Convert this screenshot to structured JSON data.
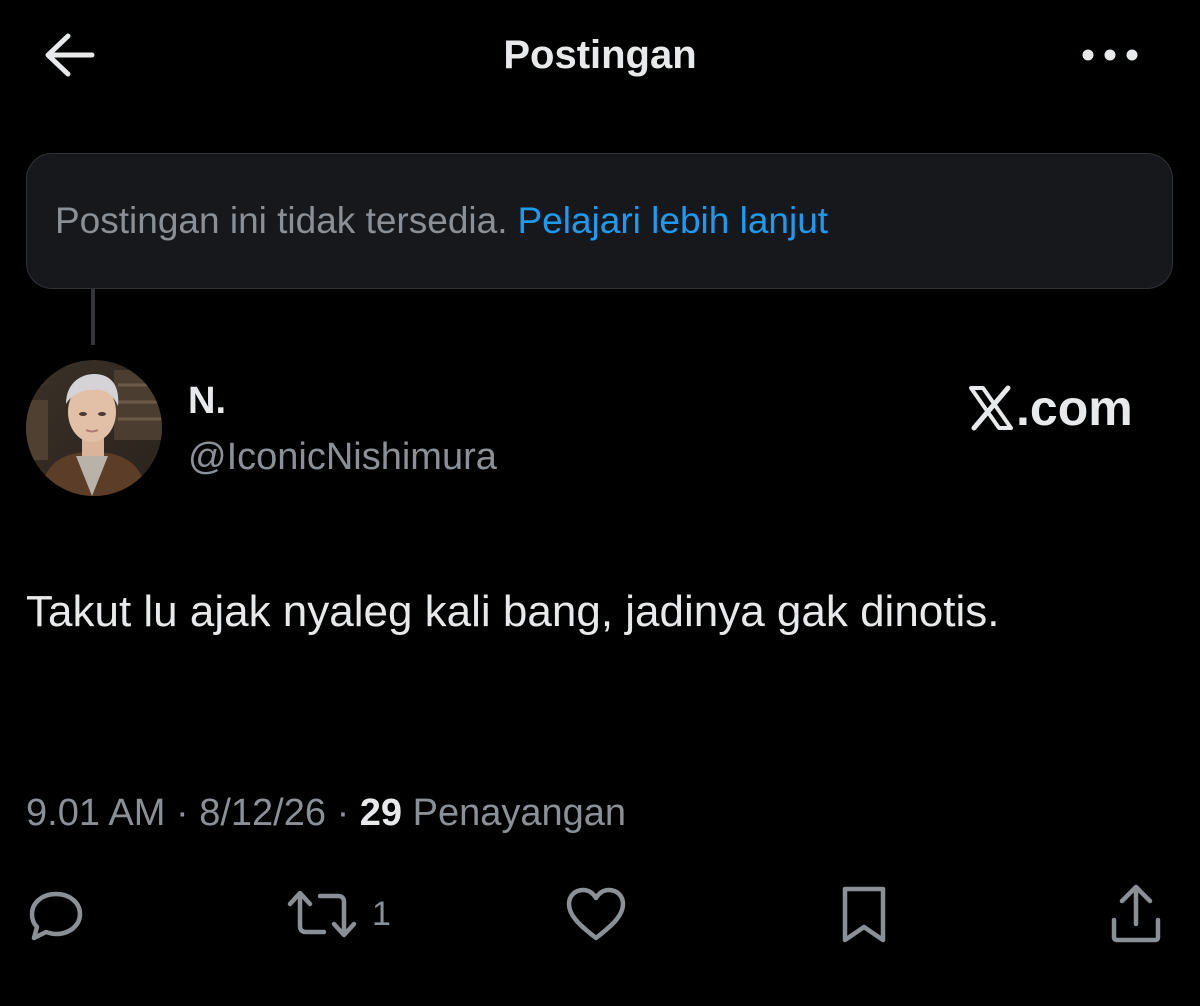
{
  "header": {
    "title": "Postingan",
    "back_icon": "arrow-left-icon",
    "more_icon": "more-horizontal-icon"
  },
  "notice": {
    "text": "Postingan ini tidak tersedia.",
    "link": "Pelajari lebih lanjut"
  },
  "author": {
    "display_name": "N.",
    "handle": "@IconicNishimura"
  },
  "brand": {
    "text": ".com",
    "icon": "x-logo-icon"
  },
  "tweet": {
    "text": "Takut lu ajak nyaleg kali bang, jadinya gak dinotis."
  },
  "meta": {
    "time": "9.01 AM",
    "separator": "·",
    "date": "8/12/26",
    "views_count": "29",
    "views_label": "Penayangan"
  },
  "actions": {
    "reply_icon": "reply-icon",
    "repost_icon": "repost-icon",
    "repost_count": "1",
    "like_icon": "heart-icon",
    "bookmark_icon": "bookmark-icon",
    "share_icon": "share-icon"
  },
  "colors": {
    "background": "#000000",
    "text": "#e7e9ea",
    "muted": "#8b9096",
    "link": "#1d9bf0",
    "notice_bg": "#16181c"
  }
}
